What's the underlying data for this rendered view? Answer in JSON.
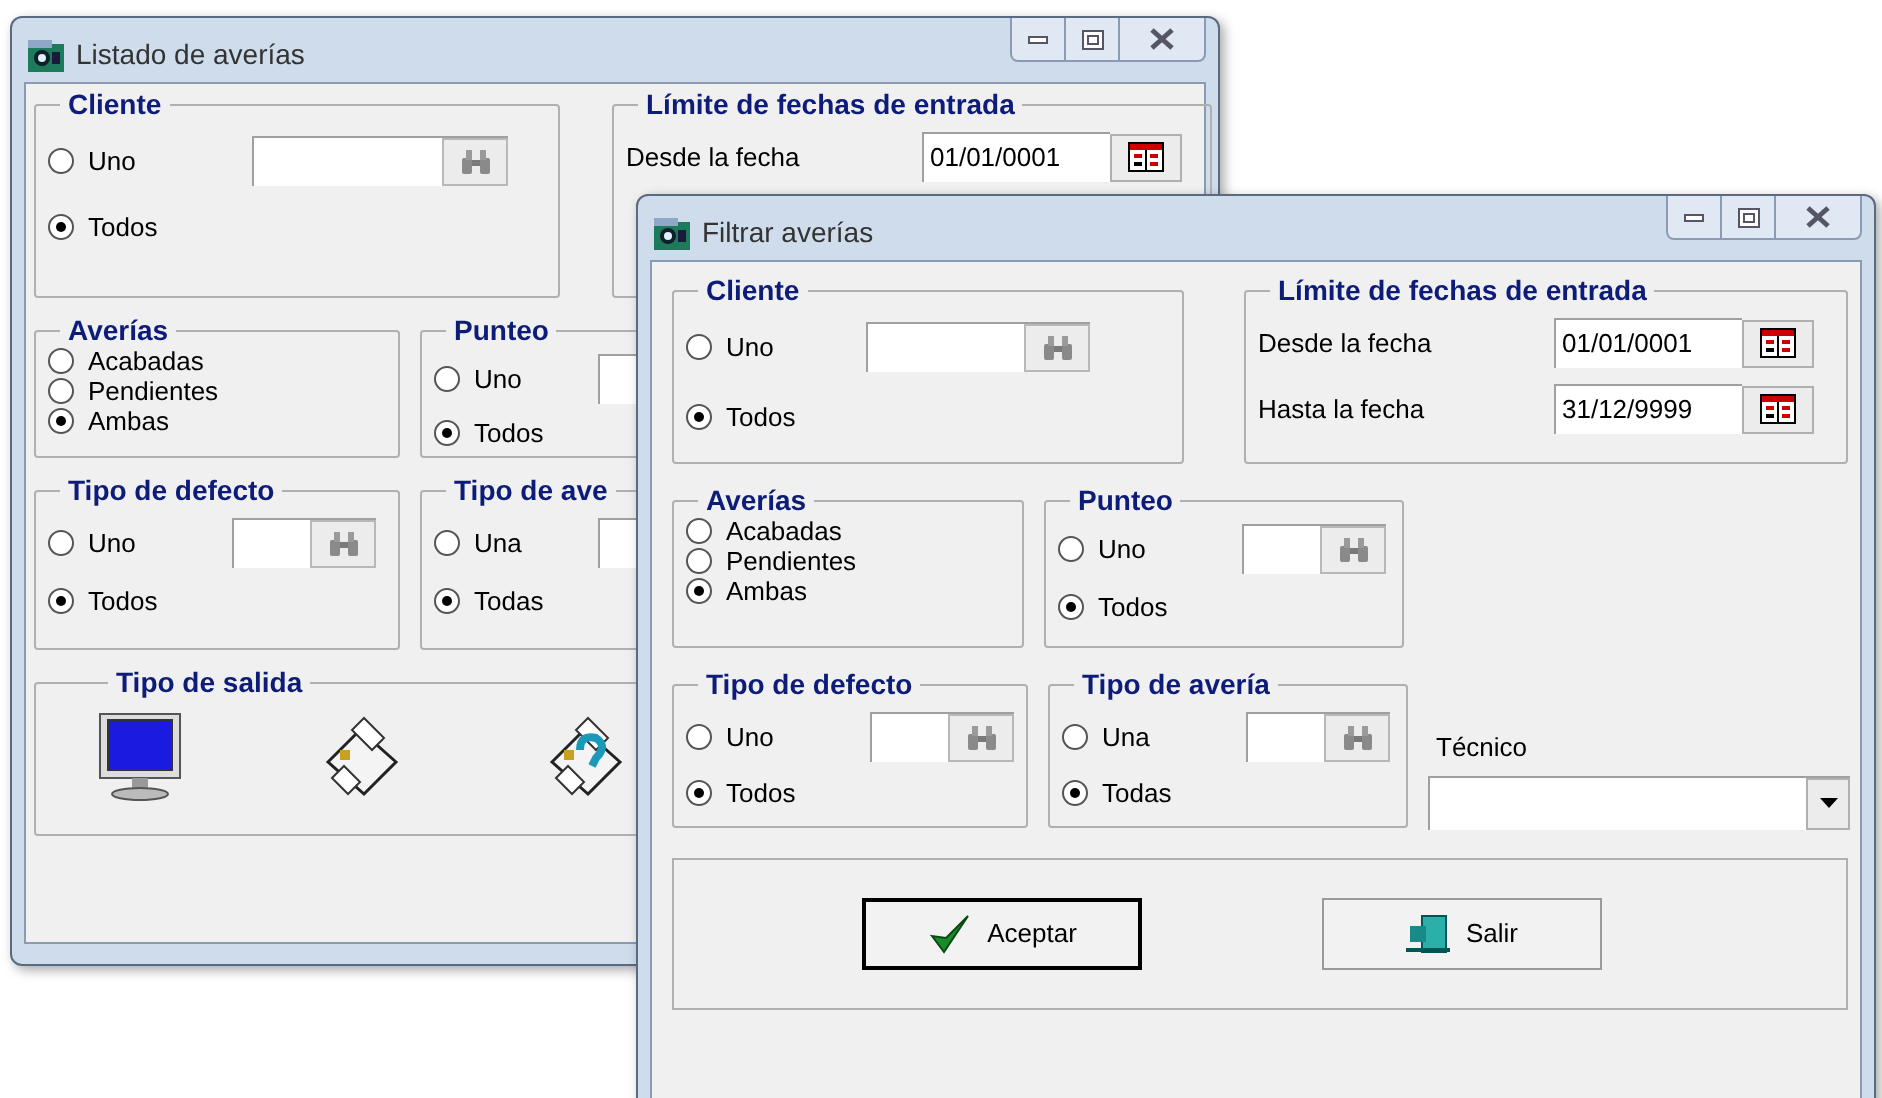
{
  "back_window": {
    "title": "Listado de averías",
    "cliente": {
      "title": "Cliente",
      "options": [
        {
          "label": "Uno",
          "selected": false,
          "kind": "lookup"
        },
        {
          "label": "Todos",
          "selected": true,
          "kind": "plain"
        }
      ]
    },
    "fechas": {
      "title": "Límite de fechas de entrada",
      "rows": [
        {
          "label": "Desde la fecha",
          "value": "01/01/0001"
        }
      ]
    },
    "averias": {
      "title": "Averías",
      "options": [
        {
          "label": "Acabadas",
          "selected": false
        },
        {
          "label": "Pendientes",
          "selected": false
        },
        {
          "label": "Ambas",
          "selected": true
        }
      ]
    },
    "punteo": {
      "title": "Punteo",
      "options": [
        {
          "label": "Uno",
          "selected": false,
          "kind": "lookup"
        },
        {
          "label": "Todos",
          "selected": true,
          "kind": "plain"
        }
      ]
    },
    "tipo_defecto": {
      "title": "Tipo de defecto",
      "options": [
        {
          "label": "Uno",
          "selected": false,
          "kind": "lookup"
        },
        {
          "label": "Todos",
          "selected": true,
          "kind": "plain"
        }
      ]
    },
    "tipo_averia": {
      "title": "Tipo de ave",
      "options": [
        {
          "label": "Una",
          "selected": false,
          "kind": "lookup"
        },
        {
          "label": "Todas",
          "selected": true,
          "kind": "plain"
        }
      ]
    },
    "tipo_salida": {
      "title": "Tipo de salida"
    }
  },
  "front_window": {
    "title": "Filtrar averías",
    "cliente": {
      "title": "Cliente",
      "options": [
        {
          "label": "Uno",
          "selected": false,
          "kind": "lookup"
        },
        {
          "label": "Todos",
          "selected": true,
          "kind": "plain"
        }
      ]
    },
    "fechas": {
      "title": "Límite de fechas de entrada",
      "rows": [
        {
          "label": "Desde la fecha",
          "value": "01/01/0001"
        },
        {
          "label": "Hasta la fecha",
          "value": "31/12/9999"
        }
      ]
    },
    "averias": {
      "title": "Averías",
      "options": [
        {
          "label": "Acabadas",
          "selected": false
        },
        {
          "label": "Pendientes",
          "selected": false
        },
        {
          "label": "Ambas",
          "selected": true
        }
      ]
    },
    "punteo": {
      "title": "Punteo",
      "options": [
        {
          "label": "Uno",
          "selected": false,
          "kind": "lookup"
        },
        {
          "label": "Todos",
          "selected": true,
          "kind": "plain"
        }
      ]
    },
    "tipo_defecto": {
      "title": "Tipo de defecto",
      "options": [
        {
          "label": "Uno",
          "selected": false,
          "kind": "lookup"
        },
        {
          "label": "Todos",
          "selected": true,
          "kind": "plain"
        }
      ]
    },
    "tipo_averia": {
      "title": "Tipo de avería",
      "options": [
        {
          "label": "Una",
          "selected": false,
          "kind": "lookup"
        },
        {
          "label": "Todas",
          "selected": true,
          "kind": "plain"
        }
      ]
    },
    "tecnico": {
      "label": "Técnico"
    },
    "buttons": [
      {
        "label": "Aceptar",
        "kind": "accept",
        "default": true
      },
      {
        "label": "Salir",
        "kind": "exit",
        "default": false
      }
    ]
  }
}
